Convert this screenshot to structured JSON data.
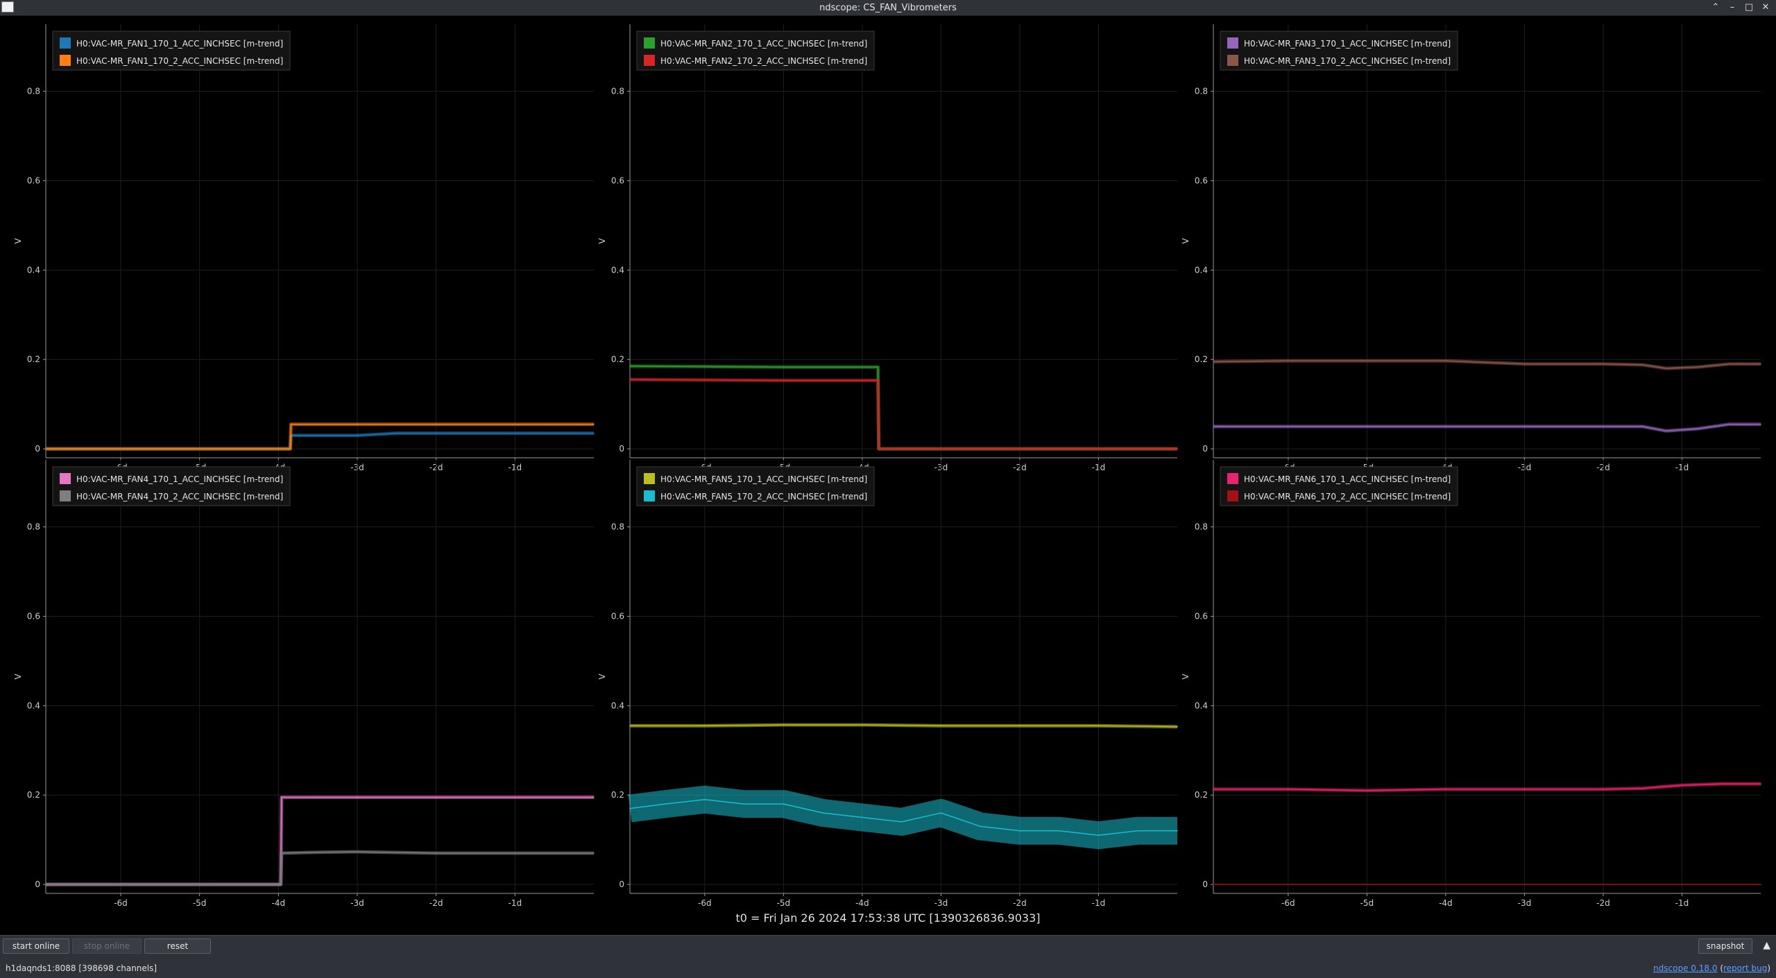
{
  "window": {
    "title": "ndscope: CS_FAN_Vibrometers",
    "controls": [
      "chevron-up-icon",
      "minimize-icon",
      "maximize-icon",
      "close-icon"
    ]
  },
  "plots": [
    {
      "id": "fan1",
      "ylabel": "V",
      "legend": [
        {
          "label": "H0:VAC-MR_FAN1_170_1_ACC_INCHSEC [m-trend]",
          "color": "#1f77b4"
        },
        {
          "label": "H0:VAC-MR_FAN1_170_2_ACC_INCHSEC [m-trend]",
          "color": "#ff7f0e"
        }
      ]
    },
    {
      "id": "fan2",
      "ylabel": "V",
      "legend": [
        {
          "label": "H0:VAC-MR_FAN2_170_1_ACC_INCHSEC [m-trend]",
          "color": "#2ca02c"
        },
        {
          "label": "H0:VAC-MR_FAN2_170_2_ACC_INCHSEC [m-trend]",
          "color": "#d62728"
        }
      ]
    },
    {
      "id": "fan3",
      "ylabel": "V",
      "legend": [
        {
          "label": "H0:VAC-MR_FAN3_170_1_ACC_INCHSEC [m-trend]",
          "color": "#9467bd"
        },
        {
          "label": "H0:VAC-MR_FAN3_170_2_ACC_INCHSEC [m-trend]",
          "color": "#8c564b"
        }
      ]
    },
    {
      "id": "fan4",
      "ylabel": "V",
      "legend": [
        {
          "label": "H0:VAC-MR_FAN4_170_1_ACC_INCHSEC [m-trend]",
          "color": "#e377c2"
        },
        {
          "label": "H0:VAC-MR_FAN4_170_2_ACC_INCHSEC [m-trend]",
          "color": "#7f7f7f"
        }
      ]
    },
    {
      "id": "fan5",
      "ylabel": "V",
      "legend": [
        {
          "label": "H0:VAC-MR_FAN5_170_1_ACC_INCHSEC [m-trend]",
          "color": "#bcbd22"
        },
        {
          "label": "H0:VAC-MR_FAN5_170_2_ACC_INCHSEC [m-trend]",
          "color": "#17becf"
        }
      ]
    },
    {
      "id": "fan6",
      "ylabel": "V",
      "legend": [
        {
          "label": "H0:VAC-MR_FAN6_170_1_ACC_INCHSEC [m-trend]",
          "color": "#e8236f"
        },
        {
          "label": "H0:VAC-MR_FAN6_170_2_ACC_INCHSEC [m-trend]",
          "color": "#a50f15"
        }
      ]
    }
  ],
  "chart_data": [
    {
      "type": "line",
      "series": [
        {
          "name": "H0:VAC-MR_FAN1_170_1_ACC_INCHSEC [m-trend]",
          "x": [
            -6.95,
            -3.85,
            -3.84,
            -3.5,
            -3.0,
            -2.5,
            -2.0,
            -1.5,
            -1.0,
            -0.5,
            0
          ],
          "y": [
            0,
            0,
            0.03,
            0.03,
            0.03,
            0.035,
            0.035,
            0.035,
            0.035,
            0.035,
            0.035
          ]
        },
        {
          "name": "H0:VAC-MR_FAN1_170_2_ACC_INCHSEC [m-trend]",
          "x": [
            -6.95,
            -3.85,
            -3.84,
            -3.5,
            -3.0,
            -2.5,
            -2.0,
            -1.5,
            -1.0,
            -0.5,
            0
          ],
          "y": [
            0,
            0,
            0.055,
            0.055,
            0.055,
            0.055,
            0.055,
            0.055,
            0.055,
            0.055,
            0.055
          ]
        }
      ],
      "ylim": [
        -0.02,
        0.95
      ],
      "xticks": [
        -6,
        -5,
        -4,
        -3,
        -2,
        -1
      ],
      "xticklabels": [
        "-6d",
        "-5d",
        "-4d",
        "-3d",
        "-2d",
        "-1d"
      ],
      "yticks": [
        0,
        0.2,
        0.4,
        0.6,
        0.8
      ],
      "grid": true,
      "legend": "top-left"
    },
    {
      "type": "line",
      "series": [
        {
          "name": "H0:VAC-MR_FAN2_170_1_ACC_INCHSEC [m-trend]",
          "x": [
            -6.95,
            -5,
            -4,
            -3.8,
            -3.79,
            0
          ],
          "y": [
            0.185,
            0.183,
            0.183,
            0.183,
            0,
            0
          ]
        },
        {
          "name": "H0:VAC-MR_FAN2_170_2_ACC_INCHSEC [m-trend]",
          "x": [
            -6.95,
            -5,
            -4,
            -3.8,
            -3.79,
            0
          ],
          "y": [
            0.155,
            0.153,
            0.153,
            0.153,
            0,
            0
          ]
        }
      ],
      "ylim": [
        -0.02,
        0.95
      ],
      "xticks": [
        -6,
        -5,
        -4,
        -3,
        -2,
        -1
      ],
      "xticklabels": [
        "-6d",
        "-5d",
        "-4d",
        "-3d",
        "-2d",
        "-1d"
      ],
      "yticks": [
        0,
        0.2,
        0.4,
        0.6,
        0.8
      ],
      "grid": true,
      "legend": "top-left"
    },
    {
      "type": "line",
      "series": [
        {
          "name": "H0:VAC-MR_FAN3_170_1_ACC_INCHSEC [m-trend]",
          "x": [
            -6.95,
            -6,
            -5,
            -4,
            -3,
            -2,
            -1.5,
            -1.2,
            -0.8,
            -0.4,
            0
          ],
          "y": [
            0.05,
            0.05,
            0.05,
            0.05,
            0.05,
            0.05,
            0.05,
            0.04,
            0.045,
            0.055,
            0.055
          ]
        },
        {
          "name": "H0:VAC-MR_FAN3_170_2_ACC_INCHSEC [m-trend]",
          "x": [
            -6.95,
            -6,
            -5,
            -4,
            -3,
            -2,
            -1.5,
            -1.2,
            -0.8,
            -0.4,
            0
          ],
          "y": [
            0.195,
            0.197,
            0.197,
            0.197,
            0.19,
            0.19,
            0.188,
            0.18,
            0.183,
            0.19,
            0.19
          ]
        }
      ],
      "ylim": [
        -0.02,
        0.95
      ],
      "xticks": [
        -6,
        -5,
        -4,
        -3,
        -2,
        -1
      ],
      "xticklabels": [
        "-6d",
        "-5d",
        "-4d",
        "-3d",
        "-2d",
        "-1d"
      ],
      "yticks": [
        0,
        0.2,
        0.4,
        0.6,
        0.8
      ],
      "grid": true,
      "legend": "top-left"
    },
    {
      "type": "line",
      "series": [
        {
          "name": "H0:VAC-MR_FAN4_170_1_ACC_INCHSEC [m-trend]",
          "x": [
            -6.95,
            -3.97,
            -3.96,
            -3.5,
            -3,
            -2,
            -1,
            0
          ],
          "y": [
            0,
            0,
            0.195,
            0.195,
            0.195,
            0.195,
            0.195,
            0.195
          ]
        },
        {
          "name": "H0:VAC-MR_FAN4_170_2_ACC_INCHSEC [m-trend]",
          "x": [
            -6.95,
            -3.97,
            -3.96,
            -3.5,
            -3,
            -2,
            -1,
            0
          ],
          "y": [
            0,
            0,
            0.07,
            0.072,
            0.073,
            0.07,
            0.07,
            0.07
          ]
        }
      ],
      "ylim": [
        -0.02,
        0.95
      ],
      "xticks": [
        -6,
        -5,
        -4,
        -3,
        -2,
        -1
      ],
      "xticklabels": [
        "-6d",
        "-5d",
        "-4d",
        "-3d",
        "-2d",
        "-1d"
      ],
      "yticks": [
        0,
        0.2,
        0.4,
        0.6,
        0.8
      ],
      "grid": true,
      "legend": "top-left"
    },
    {
      "type": "line",
      "series": [
        {
          "name": "H0:VAC-MR_FAN5_170_1_ACC_INCHSEC [m-trend]",
          "x": [
            -6.95,
            -6,
            -5,
            -4,
            -3,
            -2,
            -1,
            0
          ],
          "y": [
            0.355,
            0.355,
            0.357,
            0.357,
            0.355,
            0.355,
            0.355,
            0.353
          ]
        },
        {
          "name": "H0:VAC-MR_FAN5_170_2_ACC_INCHSEC [m-trend]",
          "x": [
            -6.95,
            -6.5,
            -6,
            -5.5,
            -5,
            -4.5,
            -4,
            -3.5,
            -3,
            -2.5,
            -2,
            -1.5,
            -1,
            -0.5,
            0
          ],
          "y": [
            0.17,
            0.18,
            0.19,
            0.18,
            0.18,
            0.16,
            0.15,
            0.14,
            0.16,
            0.13,
            0.12,
            0.12,
            0.11,
            0.12,
            0.12
          ]
        }
      ],
      "ylim": [
        -0.02,
        0.95
      ],
      "xticks": [
        -6,
        -5,
        -4,
        -3,
        -2,
        -1
      ],
      "xticklabels": [
        "-6d",
        "-5d",
        "-4d",
        "-3d",
        "-2d",
        "-1d"
      ],
      "yticks": [
        0,
        0.2,
        0.4,
        0.6,
        0.8
      ],
      "grid": true,
      "legend": "top-left"
    },
    {
      "type": "line",
      "series": [
        {
          "name": "H0:VAC-MR_FAN6_170_1_ACC_INCHSEC [m-trend]",
          "x": [
            -6.95,
            -6,
            -5,
            -4,
            -3,
            -2,
            -1.5,
            -1,
            -0.5,
            0
          ],
          "y": [
            0.213,
            0.213,
            0.21,
            0.213,
            0.213,
            0.213,
            0.215,
            0.222,
            0.225,
            0.225
          ]
        },
        {
          "name": "H0:VAC-MR_FAN6_170_2_ACC_INCHSEC [m-trend]",
          "x": [
            -6.95,
            0
          ],
          "y": [
            0,
            0
          ]
        }
      ],
      "ylim": [
        -0.02,
        0.95
      ],
      "xticks": [
        -6,
        -5,
        -4,
        -3,
        -2,
        -1
      ],
      "xticklabels": [
        "-6d",
        "-5d",
        "-4d",
        "-3d",
        "-2d",
        "-1d"
      ],
      "yticks": [
        0,
        0.2,
        0.4,
        0.6,
        0.8
      ],
      "grid": true,
      "legend": "top-left"
    }
  ],
  "footer": {
    "t0": "t0 = Fri Jan 26 2024 17:53:38 UTC [1390326836.9033]"
  },
  "toolbar": {
    "start_online": "start online",
    "stop_online": "stop online",
    "reset": "reset",
    "snapshot": "snapshot"
  },
  "status": {
    "server": "h1daqnds1:8088  [398698 channels]",
    "version_link": "ndscope 0.18.0",
    "report_link": "report bug"
  }
}
